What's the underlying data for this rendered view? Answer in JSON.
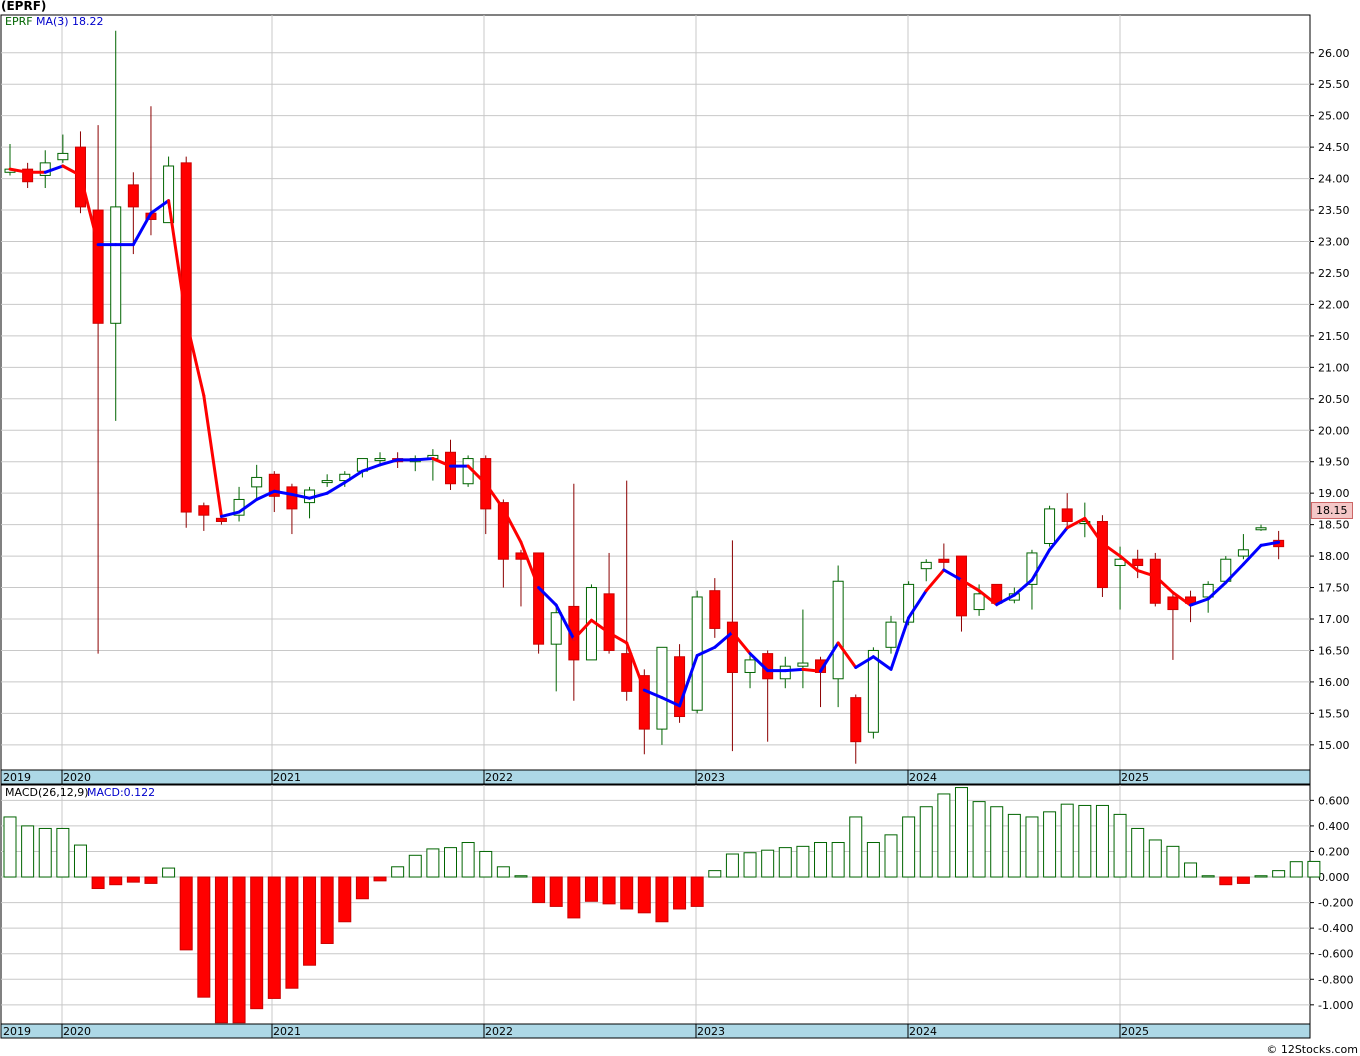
{
  "header": {
    "symbol_title": "(EPRF)",
    "legend_symbol": "EPRF",
    "legend_ma": "MA(3)",
    "legend_ma_value": "18.22",
    "legend_macd": "MACD(26,12,9)",
    "legend_macd_value": "MACD:0.122"
  },
  "price_tag": "18.15",
  "footer": "© 12Stocks.com",
  "colors": {
    "up_candle": "#006400",
    "down_candle": "#ff0000",
    "ma_down": "#ff0000",
    "ma_up": "#0000ff",
    "grid": "#c8c8c8",
    "axis_band": "#add8e6"
  },
  "chart_data": [
    {
      "type": "candlestick",
      "title": "(EPRF)",
      "ylim": [
        14.6,
        26.6
      ],
      "y_ticks": [
        "26.00",
        "25.50",
        "25.00",
        "24.50",
        "24.00",
        "23.50",
        "23.00",
        "22.50",
        "22.00",
        "21.50",
        "21.00",
        "20.50",
        "20.00",
        "19.50",
        "19.00",
        "18.50",
        "18.00",
        "17.50",
        "17.00",
        "16.50",
        "16.00",
        "15.50",
        "15.00"
      ],
      "x_tick_labels": [
        "2019",
        "2020",
        "2021",
        "2022",
        "2023",
        "2024",
        "2025"
      ],
      "year_boundary_month_index": [
        -2,
        10,
        22,
        34,
        46,
        58
      ],
      "candles": [
        {
          "o": 24.1,
          "h": 24.55,
          "l": 24.05,
          "c": 24.15
        },
        {
          "o": 24.15,
          "h": 24.25,
          "l": 23.85,
          "c": 23.95
        },
        {
          "o": 24.05,
          "h": 24.45,
          "l": 23.85,
          "c": 24.25
        },
        {
          "o": 24.3,
          "h": 24.7,
          "l": 24.25,
          "c": 24.4
        },
        {
          "o": 24.5,
          "h": 24.75,
          "l": 23.45,
          "c": 23.55
        },
        {
          "o": 23.5,
          "h": 24.85,
          "l": 16.45,
          "c": 21.7
        },
        {
          "o": 21.7,
          "h": 26.35,
          "l": 20.15,
          "c": 23.55
        },
        {
          "o": 23.9,
          "h": 24.1,
          "l": 22.8,
          "c": 23.55
        },
        {
          "o": 23.45,
          "h": 25.15,
          "l": 23.1,
          "c": 23.35
        },
        {
          "o": 23.3,
          "h": 24.35,
          "l": 23.3,
          "c": 24.2
        },
        {
          "o": 24.25,
          "h": 24.35,
          "l": 18.45,
          "c": 18.7
        },
        {
          "o": 18.8,
          "h": 18.85,
          "l": 18.4,
          "c": 18.65
        },
        {
          "o": 18.6,
          "h": 18.65,
          "l": 18.5,
          "c": 18.55
        },
        {
          "o": 18.65,
          "h": 19.1,
          "l": 18.55,
          "c": 18.9
        },
        {
          "o": 19.1,
          "h": 19.45,
          "l": 18.9,
          "c": 19.25
        },
        {
          "o": 19.3,
          "h": 19.35,
          "l": 18.7,
          "c": 18.95
        },
        {
          "o": 19.1,
          "h": 19.15,
          "l": 18.35,
          "c": 18.75
        },
        {
          "o": 18.85,
          "h": 19.1,
          "l": 18.6,
          "c": 19.05
        },
        {
          "o": 19.2,
          "h": 19.3,
          "l": 19.1,
          "c": 19.2
        },
        {
          "o": 19.2,
          "h": 19.35,
          "l": 19.1,
          "c": 19.3
        },
        {
          "o": 19.35,
          "h": 19.55,
          "l": 19.25,
          "c": 19.55
        },
        {
          "o": 19.55,
          "h": 19.65,
          "l": 19.45,
          "c": 19.55
        },
        {
          "o": 19.55,
          "h": 19.65,
          "l": 19.4,
          "c": 19.5
        },
        {
          "o": 19.5,
          "h": 19.6,
          "l": 19.35,
          "c": 19.55
        },
        {
          "o": 19.55,
          "h": 19.7,
          "l": 19.2,
          "c": 19.6
        },
        {
          "o": 19.65,
          "h": 19.85,
          "l": 19.05,
          "c": 19.15
        },
        {
          "o": 19.15,
          "h": 19.6,
          "l": 19.1,
          "c": 19.55
        },
        {
          "o": 19.55,
          "h": 19.6,
          "l": 18.35,
          "c": 18.75
        },
        {
          "o": 18.85,
          "h": 18.9,
          "l": 17.5,
          "c": 17.95
        },
        {
          "o": 18.05,
          "h": 18.1,
          "l": 17.2,
          "c": 17.95
        },
        {
          "o": 18.05,
          "h": 18.05,
          "l": 16.45,
          "c": 16.6
        },
        {
          "o": 16.6,
          "h": 17.25,
          "l": 15.85,
          "c": 17.1
        },
        {
          "o": 17.2,
          "h": 19.15,
          "l": 15.7,
          "c": 16.35
        },
        {
          "o": 16.35,
          "h": 17.55,
          "l": 16.35,
          "c": 17.5
        },
        {
          "o": 17.4,
          "h": 18.05,
          "l": 16.45,
          "c": 16.5
        },
        {
          "o": 16.45,
          "h": 19.2,
          "l": 15.7,
          "c": 15.85
        },
        {
          "o": 16.1,
          "h": 16.2,
          "l": 14.85,
          "c": 15.25
        },
        {
          "o": 15.25,
          "h": 16.45,
          "l": 15.0,
          "c": 16.55
        },
        {
          "o": 16.4,
          "h": 16.6,
          "l": 15.35,
          "c": 15.45
        },
        {
          "o": 15.55,
          "h": 17.45,
          "l": 15.5,
          "c": 17.35
        },
        {
          "o": 17.45,
          "h": 17.65,
          "l": 16.7,
          "c": 16.85
        },
        {
          "o": 16.95,
          "h": 18.25,
          "l": 14.9,
          "c": 16.15
        },
        {
          "o": 16.15,
          "h": 16.45,
          "l": 15.9,
          "c": 16.35
        },
        {
          "o": 16.45,
          "h": 16.5,
          "l": 15.05,
          "c": 16.05
        },
        {
          "o": 16.05,
          "h": 16.4,
          "l": 15.9,
          "c": 16.25
        },
        {
          "o": 16.25,
          "h": 17.15,
          "l": 15.9,
          "c": 16.3
        },
        {
          "o": 16.35,
          "h": 16.4,
          "l": 15.6,
          "c": 16.15
        },
        {
          "o": 16.05,
          "h": 17.85,
          "l": 15.6,
          "c": 17.6
        },
        {
          "o": 15.75,
          "h": 15.8,
          "l": 14.7,
          "c": 15.05
        },
        {
          "o": 15.2,
          "h": 16.55,
          "l": 15.1,
          "c": 16.5
        },
        {
          "o": 16.55,
          "h": 17.05,
          "l": 16.45,
          "c": 16.95
        },
        {
          "o": 16.95,
          "h": 17.6,
          "l": 16.9,
          "c": 17.55
        },
        {
          "o": 17.8,
          "h": 17.95,
          "l": 17.6,
          "c": 17.9
        },
        {
          "o": 17.95,
          "h": 18.2,
          "l": 17.8,
          "c": 17.9
        },
        {
          "o": 18.0,
          "h": 18.0,
          "l": 16.8,
          "c": 17.05
        },
        {
          "o": 17.15,
          "h": 17.55,
          "l": 17.05,
          "c": 17.4
        },
        {
          "o": 17.55,
          "h": 17.55,
          "l": 17.2,
          "c": 17.25
        },
        {
          "o": 17.3,
          "h": 17.5,
          "l": 17.25,
          "c": 17.4
        },
        {
          "o": 17.55,
          "h": 18.1,
          "l": 17.15,
          "c": 18.05
        },
        {
          "o": 18.2,
          "h": 18.8,
          "l": 18.15,
          "c": 18.75
        },
        {
          "o": 18.75,
          "h": 19.0,
          "l": 18.45,
          "c": 18.55
        },
        {
          "o": 18.55,
          "h": 18.85,
          "l": 18.3,
          "c": 18.55
        },
        {
          "o": 18.55,
          "h": 18.65,
          "l": 17.35,
          "c": 17.5
        },
        {
          "o": 17.85,
          "h": 18.15,
          "l": 17.15,
          "c": 17.95
        },
        {
          "o": 17.95,
          "h": 18.1,
          "l": 17.65,
          "c": 17.85
        },
        {
          "o": 17.95,
          "h": 18.05,
          "l": 17.2,
          "c": 17.25
        },
        {
          "o": 17.35,
          "h": 17.4,
          "l": 16.35,
          "c": 17.15
        },
        {
          "o": 17.35,
          "h": 17.45,
          "l": 16.95,
          "c": 17.25
        },
        {
          "o": 17.35,
          "h": 17.6,
          "l": 17.1,
          "c": 17.55
        },
        {
          "o": 17.6,
          "h": 18.0,
          "l": 17.55,
          "c": 17.95
        },
        {
          "o": 18.0,
          "h": 18.35,
          "l": 17.95,
          "c": 18.1
        },
        {
          "o": 18.43,
          "h": 18.5,
          "l": 18.4,
          "c": 18.45
        },
        {
          "o": 18.25,
          "h": 18.4,
          "l": 17.95,
          "c": 18.15
        }
      ],
      "ma3": [
        24.15,
        24.1,
        24.1,
        24.2,
        24.05,
        22.95,
        22.95,
        22.95,
        23.45,
        23.65,
        21.75,
        20.55,
        18.63,
        18.7,
        18.9,
        19.03,
        18.98,
        18.92,
        19.0,
        19.17,
        19.35,
        19.45,
        19.53,
        19.53,
        19.55,
        19.43,
        19.43,
        19.15,
        18.75,
        18.22,
        17.5,
        17.22,
        16.68,
        16.98,
        16.78,
        16.62,
        15.87,
        15.75,
        15.62,
        16.42,
        16.55,
        16.79,
        16.45,
        16.18,
        16.18,
        16.2,
        16.17,
        16.62,
        16.23,
        16.4,
        16.2,
        17.02,
        17.45,
        17.78,
        17.62,
        17.45,
        17.23,
        17.38,
        17.62,
        18.1,
        18.45,
        18.6,
        18.2,
        18.0,
        17.77,
        17.68,
        17.42,
        17.22,
        17.32,
        17.58,
        17.87,
        18.17,
        18.22
      ],
      "ma_down_segments": [
        [
          0,
          2
        ],
        [
          3,
          5
        ],
        [
          9,
          12
        ],
        [
          24,
          25
        ],
        [
          26,
          30
        ],
        [
          32,
          33
        ],
        [
          33,
          36
        ],
        [
          41,
          42
        ],
        [
          45,
          46
        ],
        [
          47,
          48
        ],
        [
          52,
          53
        ],
        [
          54,
          56
        ],
        [
          60,
          62
        ],
        [
          62,
          67
        ]
      ]
    },
    {
      "type": "bar",
      "title": "MACD(26,12,9)",
      "ylim": [
        -1.15,
        0.72
      ],
      "y_ticks": [
        "0.600",
        "0.400",
        "0.200",
        "0.000",
        "-0.200",
        "-0.400",
        "-0.600",
        "-0.800",
        "-1.000"
      ],
      "x_tick_labels": [
        "2019",
        "2020",
        "2021",
        "2022",
        "2023",
        "2024",
        "2025"
      ],
      "values": [
        0.47,
        0.4,
        0.38,
        0.38,
        0.25,
        -0.09,
        -0.06,
        -0.04,
        -0.05,
        0.07,
        -0.57,
        -0.94,
        -1.14,
        -1.14,
        -1.03,
        -0.95,
        -0.87,
        -0.69,
        -0.52,
        -0.35,
        -0.17,
        -0.03,
        0.08,
        0.17,
        0.22,
        0.23,
        0.27,
        0.2,
        0.08,
        0.01,
        -0.2,
        -0.23,
        -0.32,
        -0.19,
        -0.21,
        -0.25,
        -0.28,
        -0.35,
        -0.25,
        -0.23,
        0.05,
        0.18,
        0.19,
        0.21,
        0.23,
        0.24,
        0.27,
        0.27,
        0.47,
        0.27,
        0.33,
        0.47,
        0.55,
        0.65,
        0.7,
        0.59,
        0.55,
        0.49,
        0.47,
        0.51,
        0.57,
        0.56,
        0.56,
        0.49,
        0.38,
        0.29,
        0.24,
        0.11,
        0.01,
        -0.06,
        -0.05,
        0.01,
        0.05,
        0.12,
        0.122
      ]
    }
  ]
}
